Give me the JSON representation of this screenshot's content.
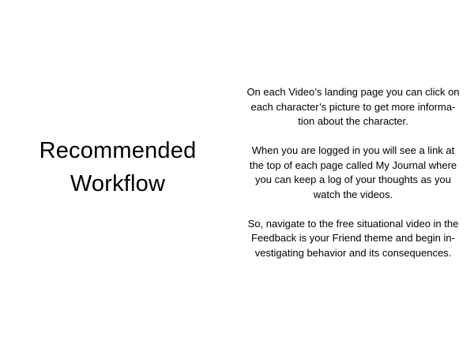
{
  "slide": {
    "title_lines": [
      "Recommended",
      "Workflow"
    ],
    "paragraphs": [
      {
        "lines": [
          "On each Video’s landing page you can click on",
          "each character’s picture to get more informa-",
          "tion about the character."
        ]
      },
      {
        "lines": [
          "When you are logged in you will see a link at",
          "the top of each page called My Journal where",
          "you can keep a log of your thoughts as you",
          "watch the videos."
        ]
      },
      {
        "lines": [
          "So, navigate to the free situational video in the",
          "Feedback is your Friend theme and begin in-",
          "vestigating behavior and its consequences."
        ]
      }
    ]
  }
}
